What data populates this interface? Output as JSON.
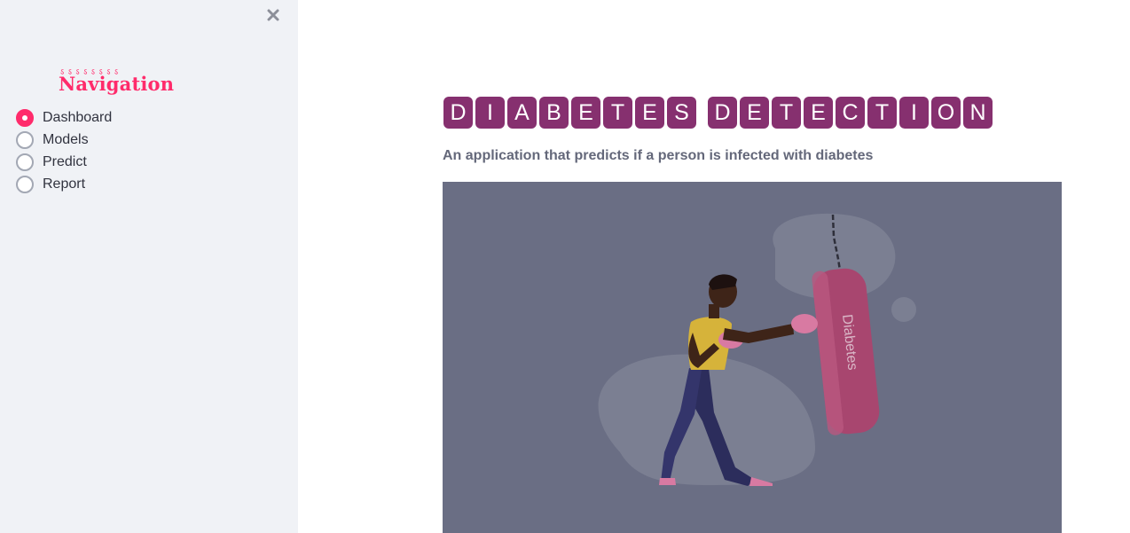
{
  "sidebar": {
    "close_icon": "close-icon",
    "title_decor": "ऽऽऽऽऽऽऽऽ",
    "title": "Navigation",
    "items": [
      {
        "label": "Dashboard",
        "selected": true
      },
      {
        "label": "Models",
        "selected": false
      },
      {
        "label": "Predict",
        "selected": false
      },
      {
        "label": "Report",
        "selected": false
      }
    ]
  },
  "main": {
    "title_words": [
      "DIABETES",
      "DETECTION"
    ],
    "subtitle": "An application that predicts if a person is infected with diabetes",
    "hero": {
      "bag_label": "Diabetes"
    }
  },
  "colors": {
    "accent": "#ff2b6b",
    "tile": "#86306f",
    "hero_bg": "#6a6e84",
    "sidebar_bg": "#f0f2f6"
  }
}
